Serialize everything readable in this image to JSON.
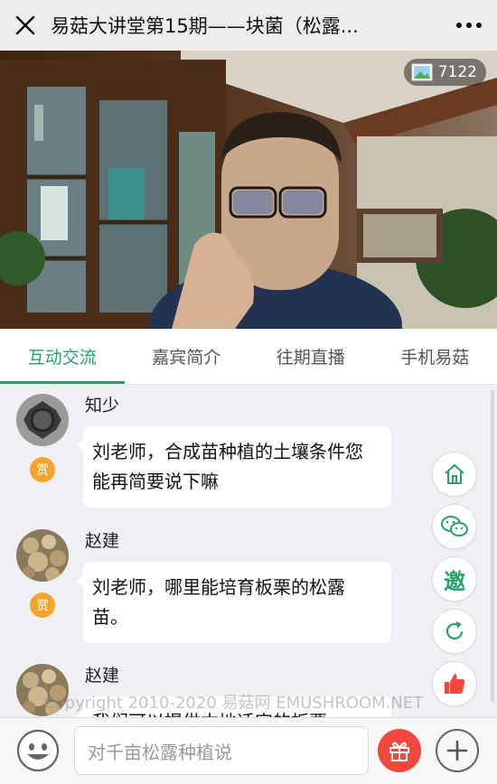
{
  "header": {
    "title": "易菇大讲堂第15期——块菌（松露...",
    "close_icon": "close-icon",
    "more_icon": "more-icon"
  },
  "video": {
    "viewer_count": "7122",
    "viewer_icon": "image-icon"
  },
  "tabs": [
    {
      "label": "互动交流",
      "active": true
    },
    {
      "label": "嘉宾简介",
      "active": false
    },
    {
      "label": "往期直播",
      "active": false
    },
    {
      "label": "手机易菇",
      "active": false
    }
  ],
  "messages": [
    {
      "name": "知少",
      "text": "刘老师，合成苗种植的土壤条件您能再简要说下嘛",
      "badge": "赏"
    },
    {
      "name": "赵建",
      "text": "刘老师，哪里能培育板栗的松露苗。",
      "badge": "赏"
    },
    {
      "name": "赵建",
      "text": "我们可以提供本地适宜的板栗"
    }
  ],
  "watermark": "Copyright 2010-2020 易菇网 EMUSHROOM.NET",
  "side_actions": {
    "yao_label": "邀",
    "icons": [
      "home-icon",
      "wechat-icon",
      "invite-icon",
      "refresh-icon",
      "thumbs-up-icon"
    ]
  },
  "composer": {
    "placeholder": "对千亩松露种植说",
    "icons": [
      "emoji-icon",
      "gift-icon",
      "plus-icon"
    ]
  },
  "colors": {
    "accent": "#25a06a",
    "reward": "#f4a32b",
    "gift": "#f0493b",
    "like": "#f0493b"
  }
}
